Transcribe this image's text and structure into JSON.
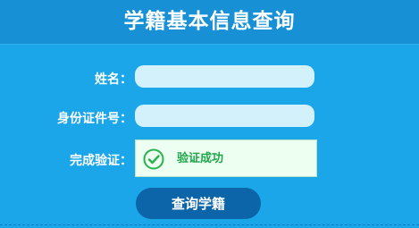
{
  "header": {
    "title": "学籍基本信息查询"
  },
  "form": {
    "name_label": "姓名：",
    "name_value": "",
    "id_label": "身份证件号：",
    "id_value": "",
    "verify_label": "完成验证：",
    "verify_status": "验证成功",
    "verify_icon": "check-circle-icon",
    "submit_label": "查询学籍"
  },
  "colors": {
    "background": "#1ba6ea",
    "header": "#1890d6",
    "input": "#d2f1fb",
    "success": "#1fa64a",
    "button": "#0b65a8"
  }
}
